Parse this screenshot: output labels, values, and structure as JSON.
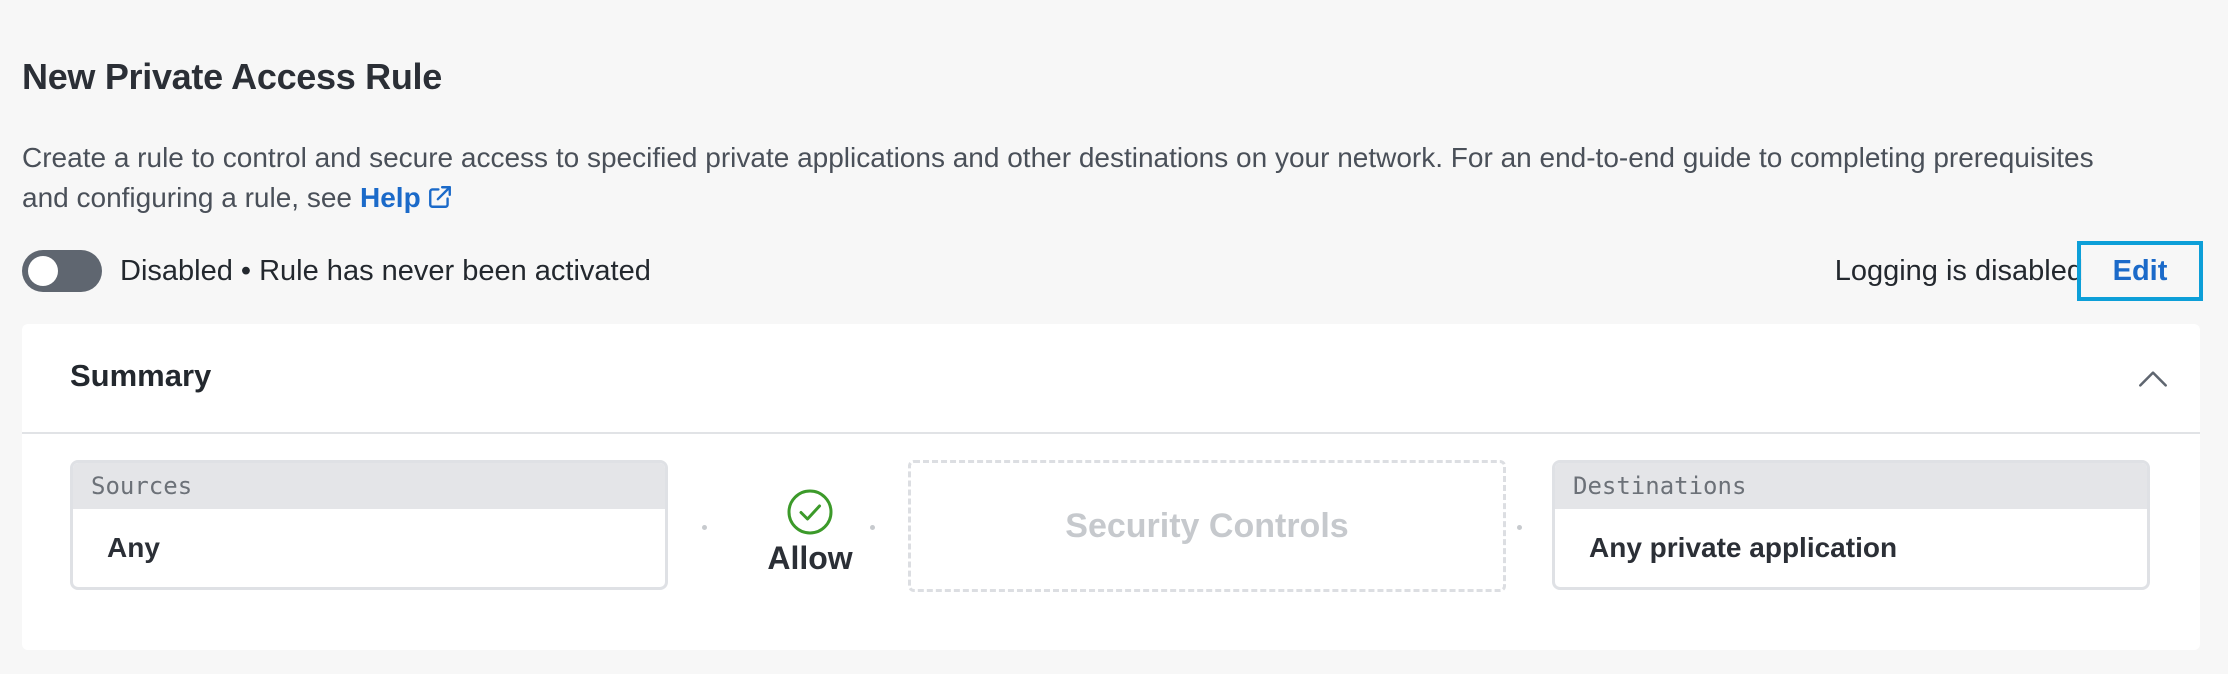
{
  "page": {
    "title": "New Private Access Rule",
    "description": "Create a rule to control and secure access to specified private applications and other destinations on your network. For an end-to-end guide to completing prerequisites and configuring a rule, see",
    "help_label": "Help"
  },
  "status": {
    "toggle_state": "off",
    "text": "Disabled • Rule has never been activated"
  },
  "logging": {
    "label": "Logging is disabled",
    "edit_label": "Edit"
  },
  "summary": {
    "title": "Summary",
    "collapse_icon": "chevron-up-icon",
    "sources": {
      "header": "Sources",
      "value": "Any"
    },
    "action": {
      "icon": "check-circle-icon",
      "label": "Allow",
      "color": "#3c9a2a"
    },
    "security_controls": {
      "label": "Security Controls"
    },
    "destinations": {
      "header": "Destinations",
      "value": "Any private application"
    }
  },
  "colors": {
    "link": "#1b6ac9",
    "focus_outline": "#0d9fd8",
    "toggle_off": "#5f6670"
  }
}
